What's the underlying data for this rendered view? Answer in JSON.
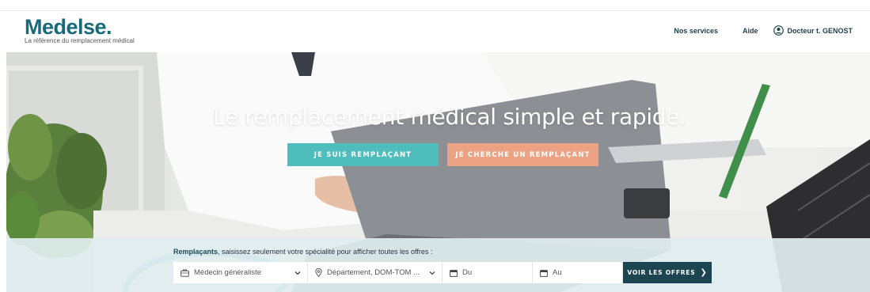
{
  "brand": {
    "name": "Medelse.",
    "tagline": "La référence du remplacement médical",
    "color": "#176a7a"
  },
  "nav": {
    "services": "Nos services",
    "help": "Aide",
    "user": "Docteur t. GENOST",
    "user_icon": "user-circle-icon"
  },
  "hero": {
    "title": "Le remplacement médical simple et rapide.",
    "cta_replacement": "JE SUIS REMPLAÇANT",
    "cta_seek": "JE CHERCHE UN REMPLAÇANT",
    "cta_replacement_color": "#4fbdbb",
    "cta_seek_color": "#eea284"
  },
  "search": {
    "hint_strong": "Remplaçants",
    "hint_rest": ", saisissez seulement votre spécialité pour afficher toutes les offres :",
    "specialty": "Médecin généraliste",
    "location": "Département, DOM-TOM ...",
    "date_from": "Du",
    "date_to": "Au",
    "submit": "VOIR LES OFFRES",
    "submit_color": "#1d4551"
  }
}
